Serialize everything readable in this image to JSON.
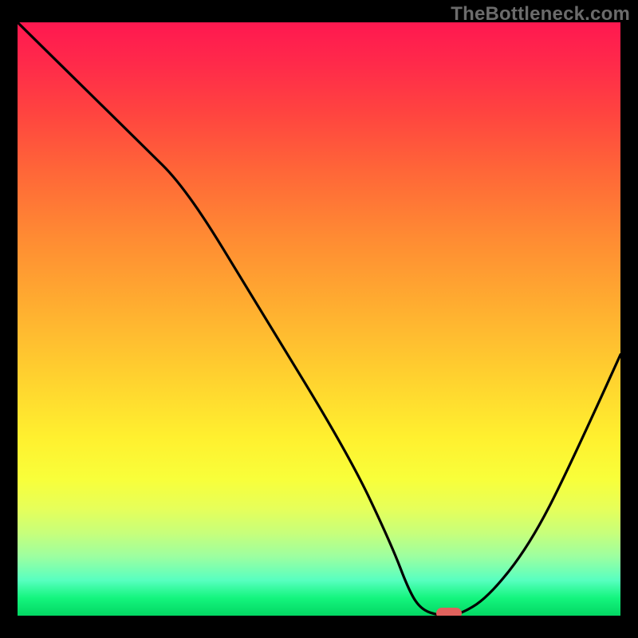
{
  "watermark": "TheBottleneck.com",
  "colors": {
    "background": "#000000",
    "curve": "#000000",
    "marker": "#e0625d",
    "watermark_text": "#6b6b6b"
  },
  "chart_data": {
    "type": "line",
    "title": "",
    "xlabel": "",
    "ylabel": "",
    "xlim": [
      0,
      100
    ],
    "ylim": [
      0,
      100
    ],
    "series": [
      {
        "name": "bottleneck-curve",
        "x": [
          0,
          8,
          20,
          28,
          40,
          55,
          62,
          65,
          67,
          70,
          73,
          78,
          85,
          92,
          100
        ],
        "values": [
          100,
          92,
          80,
          72,
          52,
          27,
          12,
          4,
          1,
          0,
          0,
          3,
          12,
          26,
          44
        ]
      }
    ],
    "marker": {
      "x": 71.5,
      "y": 0
    },
    "gradient_stops": [
      {
        "offset": 0,
        "color": "#ff1850"
      },
      {
        "offset": 50,
        "color": "#ffb030"
      },
      {
        "offset": 78,
        "color": "#f8ff3a"
      },
      {
        "offset": 100,
        "color": "#03d763"
      }
    ]
  }
}
